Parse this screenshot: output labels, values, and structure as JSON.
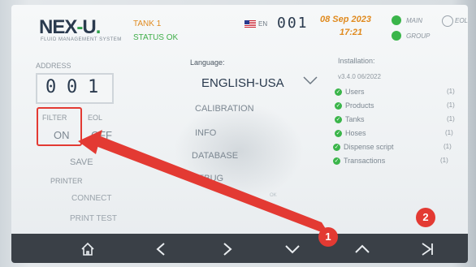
{
  "header": {
    "logo_text": "NEX",
    "logo_u": "U",
    "logo_sub": "FLUID MANAGEMENT SYSTEM",
    "tank_label": "TANK 1",
    "tank_status": "STATUS OK",
    "language_code": "EN",
    "device_number": "001",
    "date": "08 Sep 2023",
    "time": "17:21",
    "main_label": "MAIN",
    "eol_label": "EOL",
    "group_label": "GROUP"
  },
  "left": {
    "address_label": "ADDRESS",
    "address_digits": [
      "0",
      "0",
      "1"
    ],
    "filter_label": "FILTER",
    "filter_value": "ON",
    "eol_label": "EOL",
    "eol_value": "OFF",
    "save_label": "SAVE",
    "printer_label": "PRINTER",
    "connect_label": "CONNECT",
    "print_test_label": "PRINT TEST"
  },
  "middle": {
    "language_label": "Language:",
    "language_value": "ENGLISH-USA",
    "menu": [
      "CALIBRATION",
      "INFO",
      "DATABASE",
      "DEBUG"
    ],
    "ok_text": "OK"
  },
  "installation": {
    "title": "Installation:",
    "version": "v3.4.0 06/2022",
    "items": [
      {
        "label": "Users",
        "count": "(1)"
      },
      {
        "label": "Products",
        "count": "(1)"
      },
      {
        "label": "Tanks",
        "count": "(1)"
      },
      {
        "label": "Hoses",
        "count": "(1)"
      },
      {
        "label": "Dispense script",
        "count": "(1)"
      },
      {
        "label": "Transactions",
        "count": "(1)"
      }
    ]
  },
  "navbar": {
    "icons": [
      "home-icon",
      "back-icon",
      "forward-icon",
      "chevron-down-icon",
      "chevron-up-icon",
      "skip-end-icon"
    ]
  },
  "annotations": {
    "badge_1": "1",
    "badge_2": "2"
  },
  "colors": {
    "accent_orange": "#e08a1e",
    "status_green": "#3ab54a",
    "annotation_red": "#e33a33",
    "navbar": "#3a4047"
  }
}
